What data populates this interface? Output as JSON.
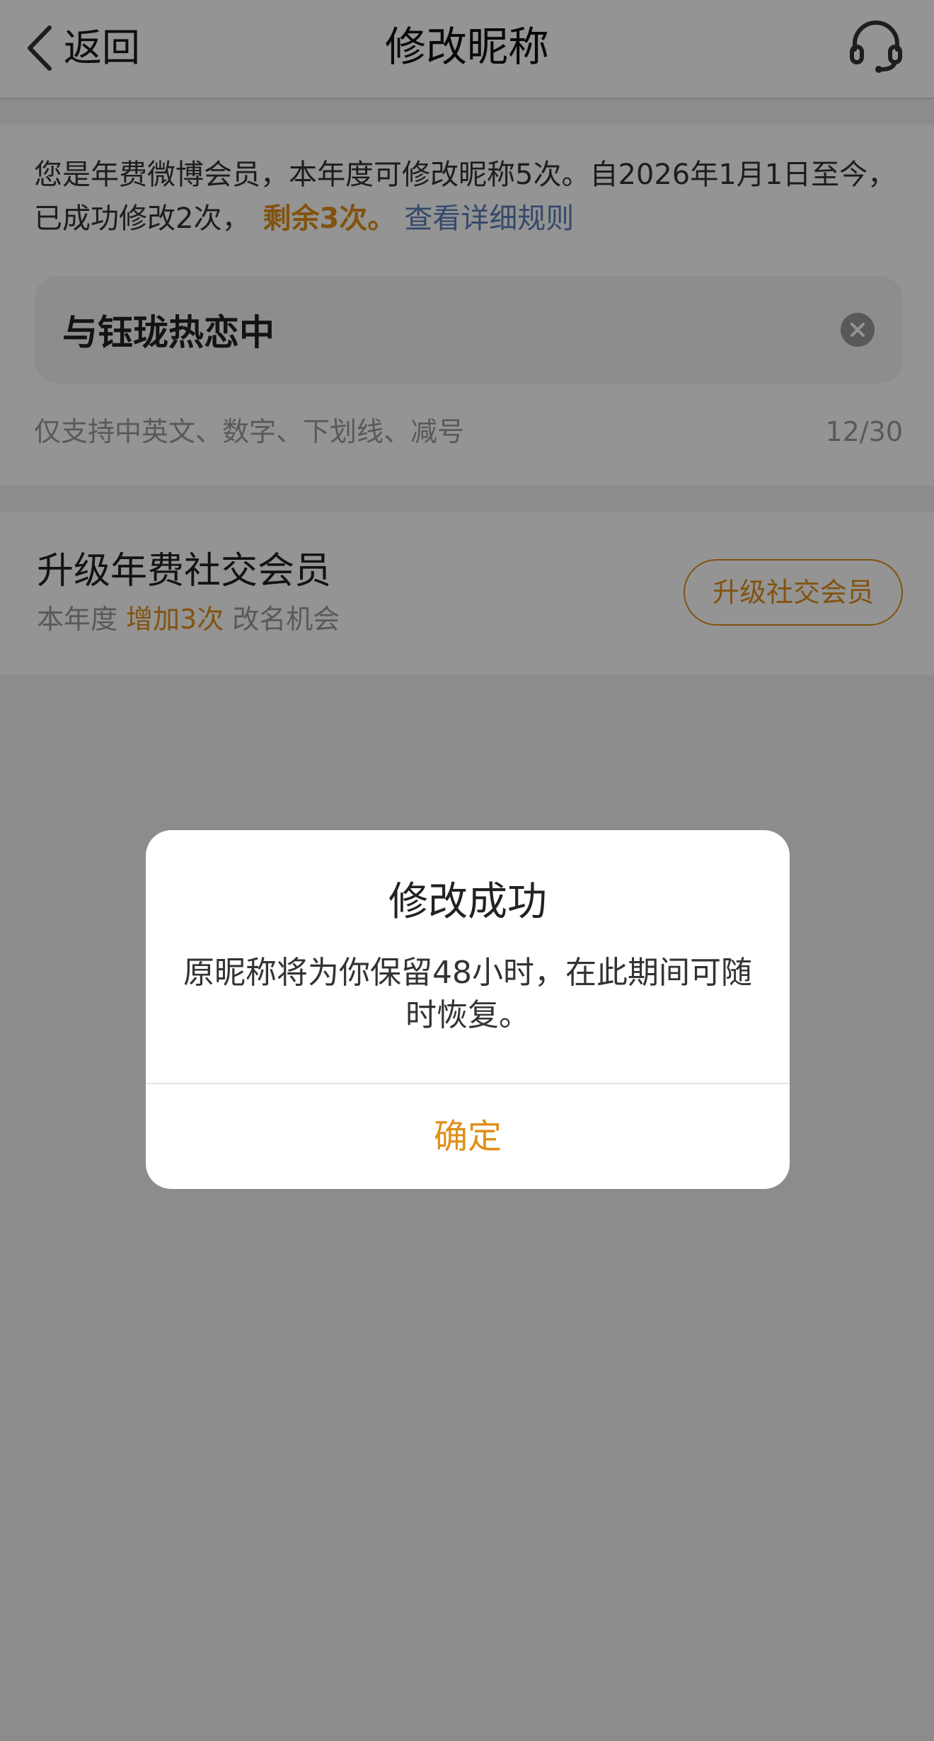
{
  "nav": {
    "back_label": "返回",
    "title": "修改昵称",
    "back_icon": "chevron-left-icon",
    "service_icon": "headset-icon"
  },
  "info": {
    "description": "您是年费微博会员，本年度可修改昵称5次。自2026年1月1日至今，已成功修改2次，",
    "remaining": "剩余3次。",
    "rules_link": "查看详细规则"
  },
  "nickname_input": {
    "value": "与钰珑热恋中",
    "clear_icon": "clear-circle-icon",
    "hint": "仅支持中英文、数字、下划线、减号",
    "char_count": "12/30"
  },
  "upgrade": {
    "title": "升级年费社交会员",
    "sub_prefix": "本年度",
    "sub_highlight": "增加3次",
    "sub_suffix": "改名机会",
    "button_label": "升级社交会员"
  },
  "dialog": {
    "title": "修改成功",
    "message": "原昵称将为你保留48小时，在此期间可随时恢复。",
    "confirm_label": "确定"
  },
  "colors": {
    "accent": "#e08f1a",
    "link": "#5a7fb8",
    "overlay": "rgba(0,0,0,0.42)"
  }
}
